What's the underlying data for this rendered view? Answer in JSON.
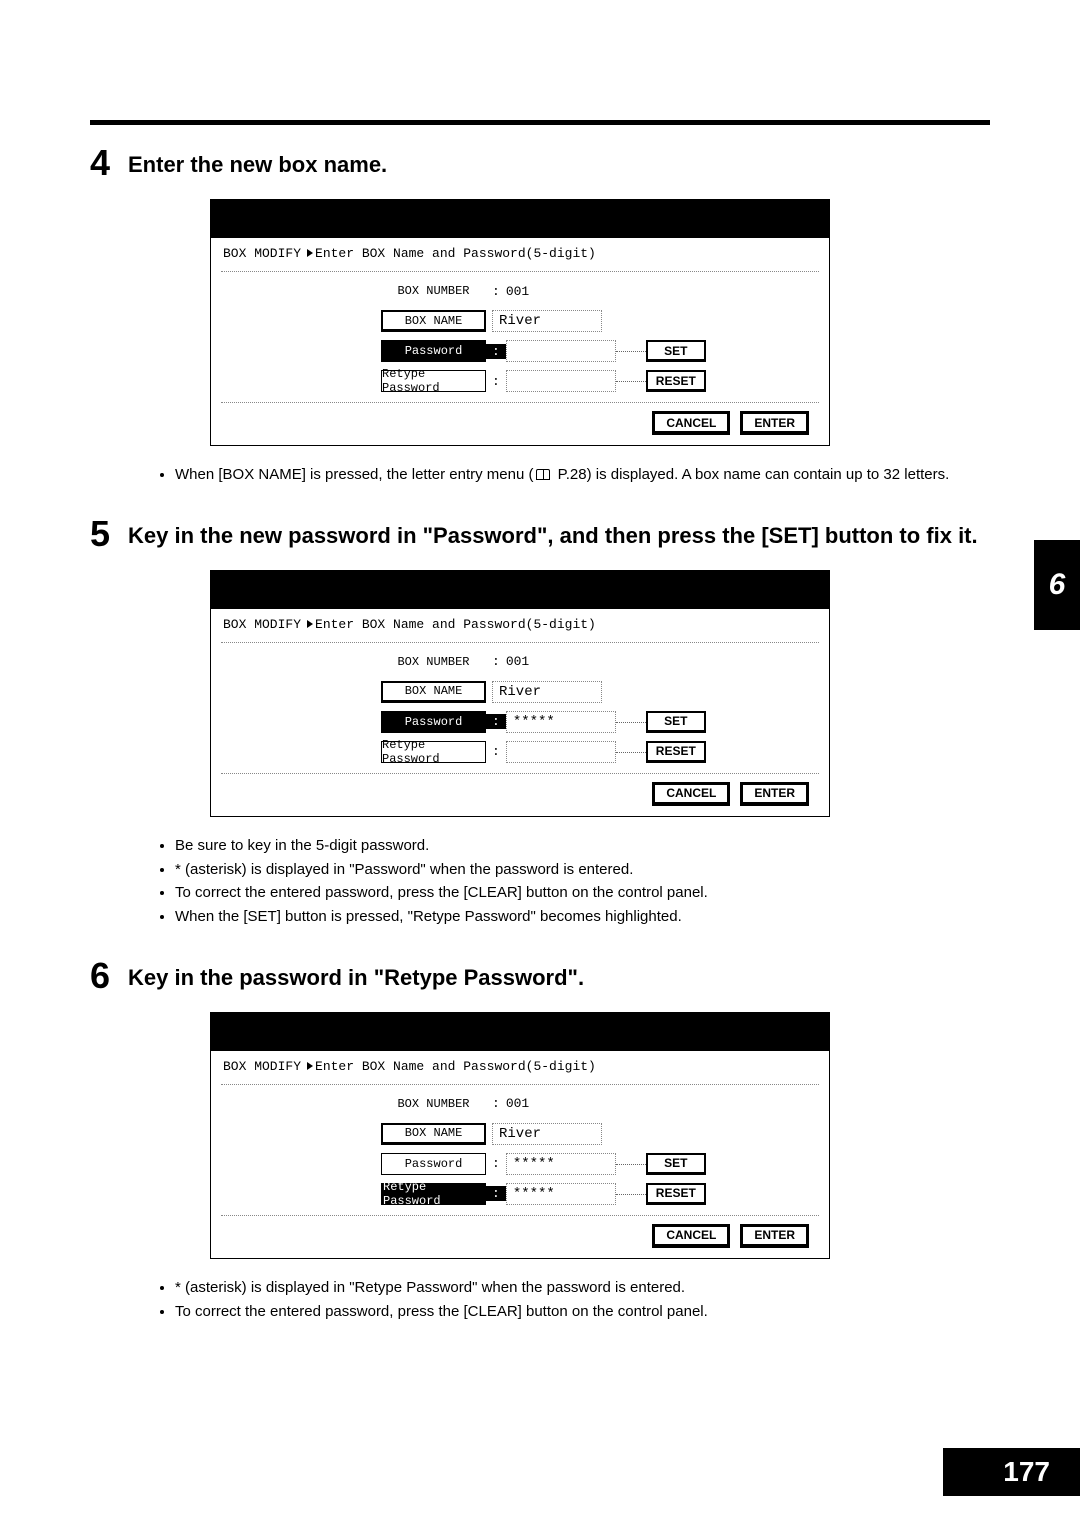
{
  "chapter_tab": "6",
  "page_number": "177",
  "panel_header": {
    "prefix": "BOX MODIFY",
    "instruction": "Enter BOX Name and Password(5-digit)"
  },
  "labels": {
    "box_number": "BOX NUMBER",
    "box_name": "BOX NAME",
    "password": "Password",
    "retype": "Retype Password"
  },
  "buttons": {
    "set": "SET",
    "reset": "RESET",
    "cancel": "CANCEL",
    "enter": "ENTER"
  },
  "values": {
    "box_number": "001",
    "box_name": "River",
    "masked": "*****"
  },
  "steps": [
    {
      "num": "4",
      "title": "Enter the new box name.",
      "password_inverted": true,
      "password_value": "",
      "retype_inverted": false,
      "retype_value": "",
      "notes": [
        "When [BOX NAME] is pressed, the letter entry menu (📖 P.28) is displayed. A box name can contain up to 32 letters."
      ]
    },
    {
      "num": "5",
      "title": "Key in the new password in \"Password\", and then press the [SET] button to fix it.",
      "password_inverted": true,
      "password_value": "*****",
      "retype_inverted": false,
      "retype_value": "",
      "notes": [
        "Be sure to key in the 5-digit password.",
        "* (asterisk) is displayed in \"Password\" when the password is entered.",
        "To correct the entered password, press the [CLEAR] button on the control panel.",
        "When the [SET] button is pressed, \"Retype Password\" becomes highlighted."
      ]
    },
    {
      "num": "6",
      "title": "Key in the password in \"Retype Password\".",
      "password_inverted": false,
      "password_value": "*****",
      "retype_inverted": true,
      "retype_value": "*****",
      "notes": [
        "* (asterisk) is displayed in \"Retype Password\" when the password is entered.",
        "To correct the entered password, press the [CLEAR] button on the control panel."
      ]
    }
  ]
}
